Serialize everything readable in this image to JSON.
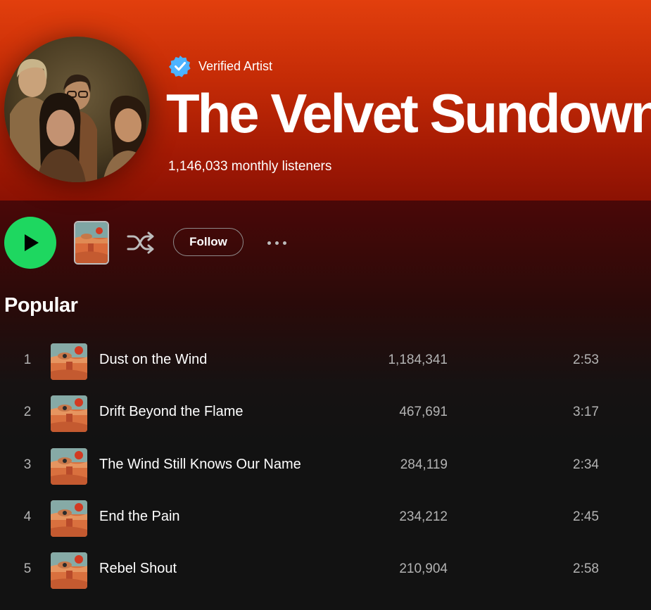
{
  "artist": {
    "verified_label": "Verified Artist",
    "name": "The Velvet Sundown",
    "monthly_listeners": "1,146,033 monthly listeners"
  },
  "controls": {
    "play_icon": "play-icon",
    "shuffle_icon": "shuffle-icon",
    "follow_label": "Follow",
    "more_icon": "more-options-icon"
  },
  "popular": {
    "title": "Popular",
    "tracks": [
      {
        "number": "1",
        "title": "Dust on the Wind",
        "plays": "1,184,341",
        "duration": "2:53"
      },
      {
        "number": "2",
        "title": "Drift Beyond the Flame",
        "plays": "467,691",
        "duration": "3:17"
      },
      {
        "number": "3",
        "title": "The Wind Still Knows Our Name",
        "plays": "284,119",
        "duration": "2:34"
      },
      {
        "number": "4",
        "title": "End the Pain",
        "plays": "234,212",
        "duration": "2:45"
      },
      {
        "number": "5",
        "title": "Rebel Shout",
        "plays": "210,904",
        "duration": "2:58"
      }
    ]
  },
  "colors": {
    "hero_top": "#e23f0d",
    "hero_bottom": "#8c1203",
    "play_green": "#1ed760",
    "verified_blue": "#4cb3ff",
    "background": "#121212",
    "muted_text": "#b3b3b3"
  }
}
